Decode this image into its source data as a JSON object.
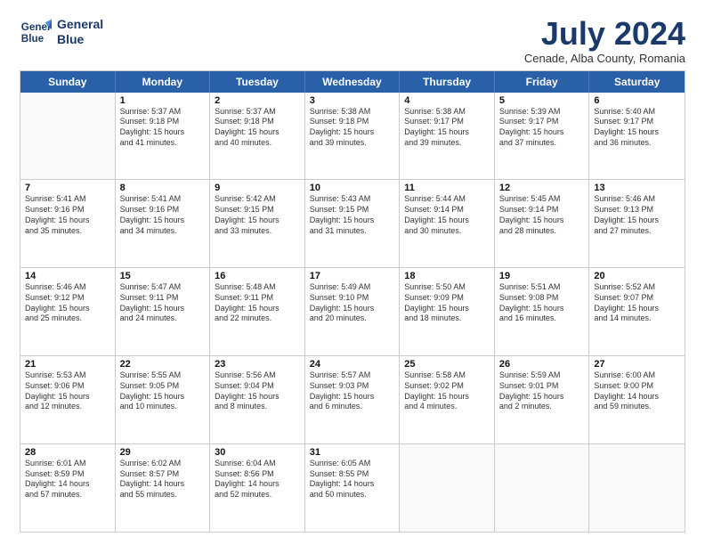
{
  "header": {
    "logo_line1": "General",
    "logo_line2": "Blue",
    "month": "July 2024",
    "location": "Cenade, Alba County, Romania"
  },
  "days": [
    "Sunday",
    "Monday",
    "Tuesday",
    "Wednesday",
    "Thursday",
    "Friday",
    "Saturday"
  ],
  "weeks": [
    [
      {
        "day": "",
        "lines": []
      },
      {
        "day": "1",
        "lines": [
          "Sunrise: 5:37 AM",
          "Sunset: 9:18 PM",
          "Daylight: 15 hours",
          "and 41 minutes."
        ]
      },
      {
        "day": "2",
        "lines": [
          "Sunrise: 5:37 AM",
          "Sunset: 9:18 PM",
          "Daylight: 15 hours",
          "and 40 minutes."
        ]
      },
      {
        "day": "3",
        "lines": [
          "Sunrise: 5:38 AM",
          "Sunset: 9:18 PM",
          "Daylight: 15 hours",
          "and 39 minutes."
        ]
      },
      {
        "day": "4",
        "lines": [
          "Sunrise: 5:38 AM",
          "Sunset: 9:17 PM",
          "Daylight: 15 hours",
          "and 39 minutes."
        ]
      },
      {
        "day": "5",
        "lines": [
          "Sunrise: 5:39 AM",
          "Sunset: 9:17 PM",
          "Daylight: 15 hours",
          "and 37 minutes."
        ]
      },
      {
        "day": "6",
        "lines": [
          "Sunrise: 5:40 AM",
          "Sunset: 9:17 PM",
          "Daylight: 15 hours",
          "and 36 minutes."
        ]
      }
    ],
    [
      {
        "day": "7",
        "lines": [
          "Sunrise: 5:41 AM",
          "Sunset: 9:16 PM",
          "Daylight: 15 hours",
          "and 35 minutes."
        ]
      },
      {
        "day": "8",
        "lines": [
          "Sunrise: 5:41 AM",
          "Sunset: 9:16 PM",
          "Daylight: 15 hours",
          "and 34 minutes."
        ]
      },
      {
        "day": "9",
        "lines": [
          "Sunrise: 5:42 AM",
          "Sunset: 9:15 PM",
          "Daylight: 15 hours",
          "and 33 minutes."
        ]
      },
      {
        "day": "10",
        "lines": [
          "Sunrise: 5:43 AM",
          "Sunset: 9:15 PM",
          "Daylight: 15 hours",
          "and 31 minutes."
        ]
      },
      {
        "day": "11",
        "lines": [
          "Sunrise: 5:44 AM",
          "Sunset: 9:14 PM",
          "Daylight: 15 hours",
          "and 30 minutes."
        ]
      },
      {
        "day": "12",
        "lines": [
          "Sunrise: 5:45 AM",
          "Sunset: 9:14 PM",
          "Daylight: 15 hours",
          "and 28 minutes."
        ]
      },
      {
        "day": "13",
        "lines": [
          "Sunrise: 5:46 AM",
          "Sunset: 9:13 PM",
          "Daylight: 15 hours",
          "and 27 minutes."
        ]
      }
    ],
    [
      {
        "day": "14",
        "lines": [
          "Sunrise: 5:46 AM",
          "Sunset: 9:12 PM",
          "Daylight: 15 hours",
          "and 25 minutes."
        ]
      },
      {
        "day": "15",
        "lines": [
          "Sunrise: 5:47 AM",
          "Sunset: 9:11 PM",
          "Daylight: 15 hours",
          "and 24 minutes."
        ]
      },
      {
        "day": "16",
        "lines": [
          "Sunrise: 5:48 AM",
          "Sunset: 9:11 PM",
          "Daylight: 15 hours",
          "and 22 minutes."
        ]
      },
      {
        "day": "17",
        "lines": [
          "Sunrise: 5:49 AM",
          "Sunset: 9:10 PM",
          "Daylight: 15 hours",
          "and 20 minutes."
        ]
      },
      {
        "day": "18",
        "lines": [
          "Sunrise: 5:50 AM",
          "Sunset: 9:09 PM",
          "Daylight: 15 hours",
          "and 18 minutes."
        ]
      },
      {
        "day": "19",
        "lines": [
          "Sunrise: 5:51 AM",
          "Sunset: 9:08 PM",
          "Daylight: 15 hours",
          "and 16 minutes."
        ]
      },
      {
        "day": "20",
        "lines": [
          "Sunrise: 5:52 AM",
          "Sunset: 9:07 PM",
          "Daylight: 15 hours",
          "and 14 minutes."
        ]
      }
    ],
    [
      {
        "day": "21",
        "lines": [
          "Sunrise: 5:53 AM",
          "Sunset: 9:06 PM",
          "Daylight: 15 hours",
          "and 12 minutes."
        ]
      },
      {
        "day": "22",
        "lines": [
          "Sunrise: 5:55 AM",
          "Sunset: 9:05 PM",
          "Daylight: 15 hours",
          "and 10 minutes."
        ]
      },
      {
        "day": "23",
        "lines": [
          "Sunrise: 5:56 AM",
          "Sunset: 9:04 PM",
          "Daylight: 15 hours",
          "and 8 minutes."
        ]
      },
      {
        "day": "24",
        "lines": [
          "Sunrise: 5:57 AM",
          "Sunset: 9:03 PM",
          "Daylight: 15 hours",
          "and 6 minutes."
        ]
      },
      {
        "day": "25",
        "lines": [
          "Sunrise: 5:58 AM",
          "Sunset: 9:02 PM",
          "Daylight: 15 hours",
          "and 4 minutes."
        ]
      },
      {
        "day": "26",
        "lines": [
          "Sunrise: 5:59 AM",
          "Sunset: 9:01 PM",
          "Daylight: 15 hours",
          "and 2 minutes."
        ]
      },
      {
        "day": "27",
        "lines": [
          "Sunrise: 6:00 AM",
          "Sunset: 9:00 PM",
          "Daylight: 14 hours",
          "and 59 minutes."
        ]
      }
    ],
    [
      {
        "day": "28",
        "lines": [
          "Sunrise: 6:01 AM",
          "Sunset: 8:59 PM",
          "Daylight: 14 hours",
          "and 57 minutes."
        ]
      },
      {
        "day": "29",
        "lines": [
          "Sunrise: 6:02 AM",
          "Sunset: 8:57 PM",
          "Daylight: 14 hours",
          "and 55 minutes."
        ]
      },
      {
        "day": "30",
        "lines": [
          "Sunrise: 6:04 AM",
          "Sunset: 8:56 PM",
          "Daylight: 14 hours",
          "and 52 minutes."
        ]
      },
      {
        "day": "31",
        "lines": [
          "Sunrise: 6:05 AM",
          "Sunset: 8:55 PM",
          "Daylight: 14 hours",
          "and 50 minutes."
        ]
      },
      {
        "day": "",
        "lines": []
      },
      {
        "day": "",
        "lines": []
      },
      {
        "day": "",
        "lines": []
      }
    ]
  ]
}
